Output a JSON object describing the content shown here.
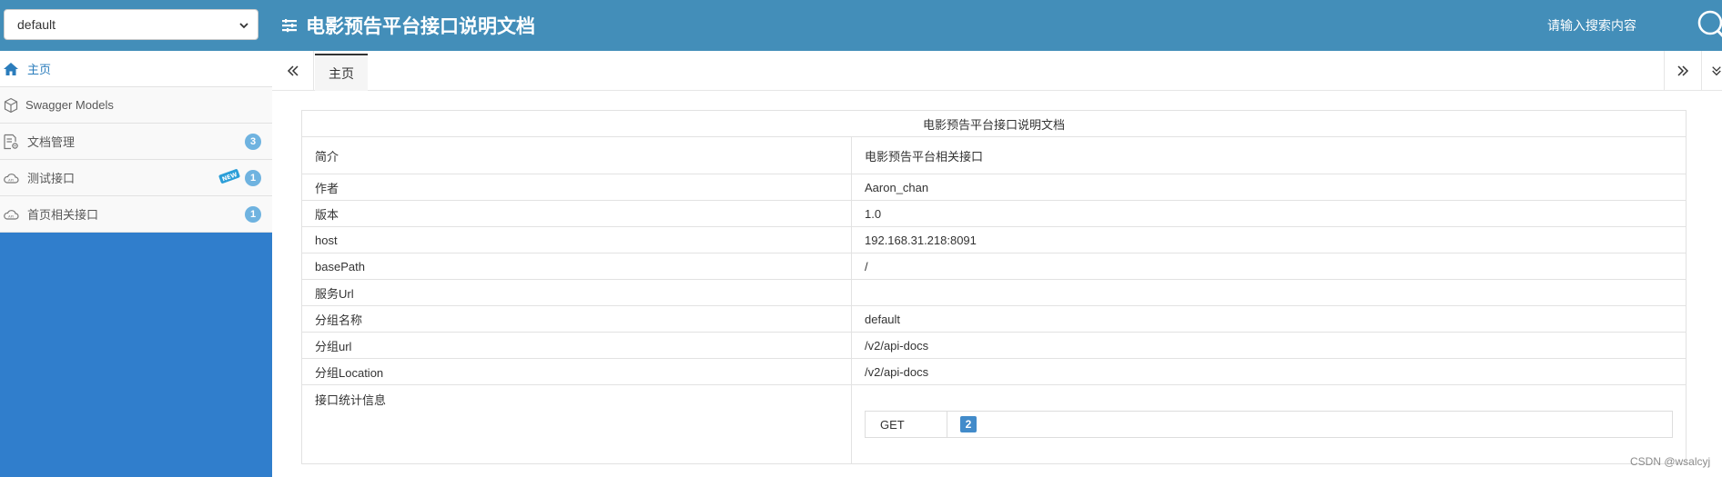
{
  "header": {
    "group_select": {
      "value": "default",
      "options": [
        "default"
      ]
    },
    "title": "电影预告平台接口说明文档",
    "search_placeholder": "请输入搜索内容",
    "bg_color": "#438eb9"
  },
  "sidebar": {
    "bg_color": "#307ecc",
    "items": [
      {
        "label": "主页",
        "icon": "home-icon",
        "active": true
      },
      {
        "label": "Swagger Models",
        "icon": "models-icon"
      },
      {
        "label": "文档管理",
        "icon": "doc-settings-icon",
        "badge": "3"
      },
      {
        "label": "测试接口",
        "icon": "api-cloud-icon",
        "badge": "1",
        "new": true
      },
      {
        "label": "首页相关接口",
        "icon": "api-cloud-icon",
        "badge": "1"
      }
    ]
  },
  "tabs": {
    "home_label": "主页"
  },
  "doc": {
    "caption": "电影预告平台接口说明文档",
    "rows": [
      {
        "label": "简介",
        "value": "电影预告平台相关接口"
      },
      {
        "label": "作者",
        "value": "Aaron_chan"
      },
      {
        "label": "版本",
        "value": "1.0"
      },
      {
        "label": "host",
        "value": "192.168.31.218:8091"
      },
      {
        "label": "basePath",
        "value": "/"
      },
      {
        "label": "服务Url",
        "value": ""
      },
      {
        "label": "分组名称",
        "value": "default"
      },
      {
        "label": "分组url",
        "value": "/v2/api-docs"
      },
      {
        "label": "分组Location",
        "value": "/v2/api-docs"
      }
    ],
    "stats": {
      "label": "接口统计信息",
      "method": "GET",
      "count": "2"
    }
  },
  "watermark": "CSDN @wsalcyj"
}
